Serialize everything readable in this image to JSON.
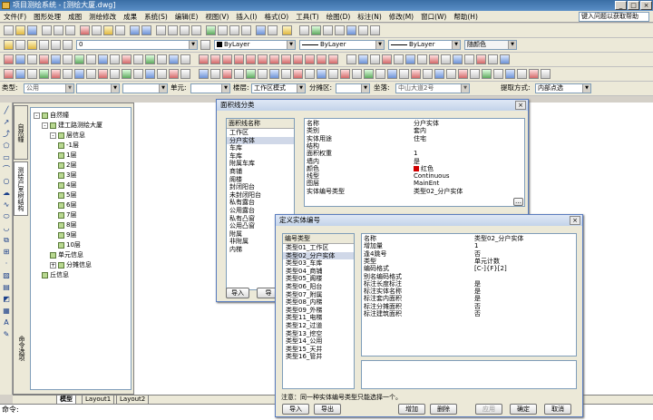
{
  "title": "项目测绘系统 - [测绘大厦.dwg]",
  "window_buttons": [
    "_",
    "□",
    "×"
  ],
  "menu": [
    "文件(F)",
    "图形处理",
    "成图",
    "测绘修改",
    "成果",
    "系统(S)",
    "编辑(E)",
    "视图(V)",
    "插入(I)",
    "格式(O)",
    "工具(T)",
    "绘图(D)",
    "标注(N)",
    "修改(M)",
    "窗口(W)",
    "帮助(H)"
  ],
  "help_placeholder": "键入问题以获取帮助",
  "toolbar": {
    "layer_value": "0",
    "color_value": "ByLayer",
    "linetype_value": "ByLayer",
    "lineweight_value": "ByLayer",
    "plotstyle_value": "随颜色"
  },
  "propbar": {
    "type_label": "类型:",
    "type_value": "公用",
    "unit_label": "单元:",
    "floor_label": "楼层:",
    "floor_value": "工作区模式",
    "zone_label": "分摊区:",
    "road_label": "坐落:",
    "road_value": "中山大道2号",
    "extract_label": "提取方式:",
    "extract_value": "内部点选"
  },
  "tree": {
    "nodes": [
      {
        "label": "自然幢",
        "level": 0,
        "exp": "-"
      },
      {
        "label": "建工路测绘大厦",
        "level": 1,
        "exp": "-"
      },
      {
        "label": "层信息",
        "level": 2,
        "exp": "-"
      },
      {
        "label": "-1层",
        "level": 3,
        "exp": ""
      },
      {
        "label": "1层",
        "level": 3,
        "exp": ""
      },
      {
        "label": "2层",
        "level": 3,
        "exp": ""
      },
      {
        "label": "3层",
        "level": 3,
        "exp": ""
      },
      {
        "label": "4层",
        "level": 3,
        "exp": ""
      },
      {
        "label": "5层",
        "level": 3,
        "exp": ""
      },
      {
        "label": "6层",
        "level": 3,
        "exp": ""
      },
      {
        "label": "7层",
        "level": 3,
        "exp": ""
      },
      {
        "label": "8层",
        "level": 3,
        "exp": ""
      },
      {
        "label": "9层",
        "level": 3,
        "exp": ""
      },
      {
        "label": "10层",
        "level": 3,
        "exp": ""
      },
      {
        "label": "单元信息",
        "level": 2,
        "exp": ""
      },
      {
        "label": "分摊信息",
        "level": 2,
        "exp": "+"
      },
      {
        "label": "丘信息",
        "level": 1,
        "exp": ""
      }
    ],
    "side_tabs": [
      "自然幢",
      "测绘户室树结构"
    ],
    "bottom_side_tab": "命令选项"
  },
  "tabs": [
    "模型",
    "Layout1",
    "Layout2"
  ],
  "command_prompt": "命令:",
  "dialog1": {
    "title": "面积线分类",
    "list_header": "面积线名称",
    "items": [
      "工作区",
      "分户实体",
      "车库",
      "车库",
      "附属车库",
      "商铺",
      "阁楼",
      "封闭阳台",
      "未封闭阳台",
      "私有露台",
      "公用露台",
      "私有凸窗",
      "公用凸窗",
      "附属",
      "非附属",
      "内梯"
    ],
    "selected_index": 1,
    "props": [
      {
        "k": "名称",
        "v": "分户实体"
      },
      {
        "k": "类别",
        "v": "套内"
      },
      {
        "k": "实体用途",
        "v": "住宅"
      },
      {
        "k": "结构",
        "v": ""
      },
      {
        "k": "面积权重",
        "v": "1"
      },
      {
        "k": "墙内",
        "v": "是"
      },
      {
        "k": "颜色",
        "v": "红色"
      },
      {
        "k": "线型",
        "v": "Continuous"
      },
      {
        "k": "图层",
        "v": "MainEnt"
      },
      {
        "k": "实体编号类型",
        "v": "类型02_分户实体"
      }
    ],
    "btn_import": "导入",
    "btn_export": "导",
    "swatch_color": "#d00000"
  },
  "dialog2": {
    "title": "定义实体编号",
    "list_header": "编号类型",
    "items": [
      "类型01_工作区",
      "类型02_分户实体",
      "类型03_车库",
      "类型04_商铺",
      "类型05_阁楼",
      "类型06_阳台",
      "类型07_附属",
      "类型08_内梯",
      "类型09_外梯",
      "类型11_电梯",
      "类型12_过道",
      "类型13_挖空",
      "类型14_公用",
      "类型15_天井",
      "类型16_管井"
    ],
    "selected_index": 1,
    "props": [
      {
        "k": "名称",
        "v": "类型02_分户实体"
      },
      {
        "k": "增加量",
        "v": "1"
      },
      {
        "k": "逢4跳号",
        "v": "否"
      },
      {
        "k": "类型",
        "v": "单元计数"
      },
      {
        "k": "编码格式",
        "v": "[C-]{F}[2]"
      },
      {
        "k": "别名编码格式",
        "v": ""
      },
      {
        "k": "标注长度标注",
        "v": "是"
      },
      {
        "k": "标注实体名称",
        "v": "是"
      },
      {
        "k": "标注套内面积",
        "v": "是"
      },
      {
        "k": "标注分摊面积",
        "v": "否"
      },
      {
        "k": "标注建筑面积",
        "v": "否"
      }
    ],
    "note": "注意：同一种实体编号类型只能选择一个。",
    "btn_import": "导入",
    "btn_export": "导出",
    "btn_add": "增加",
    "btn_delete": "删除",
    "btn_apply": "应用",
    "btn_ok": "确定",
    "btn_cancel": "取消"
  }
}
